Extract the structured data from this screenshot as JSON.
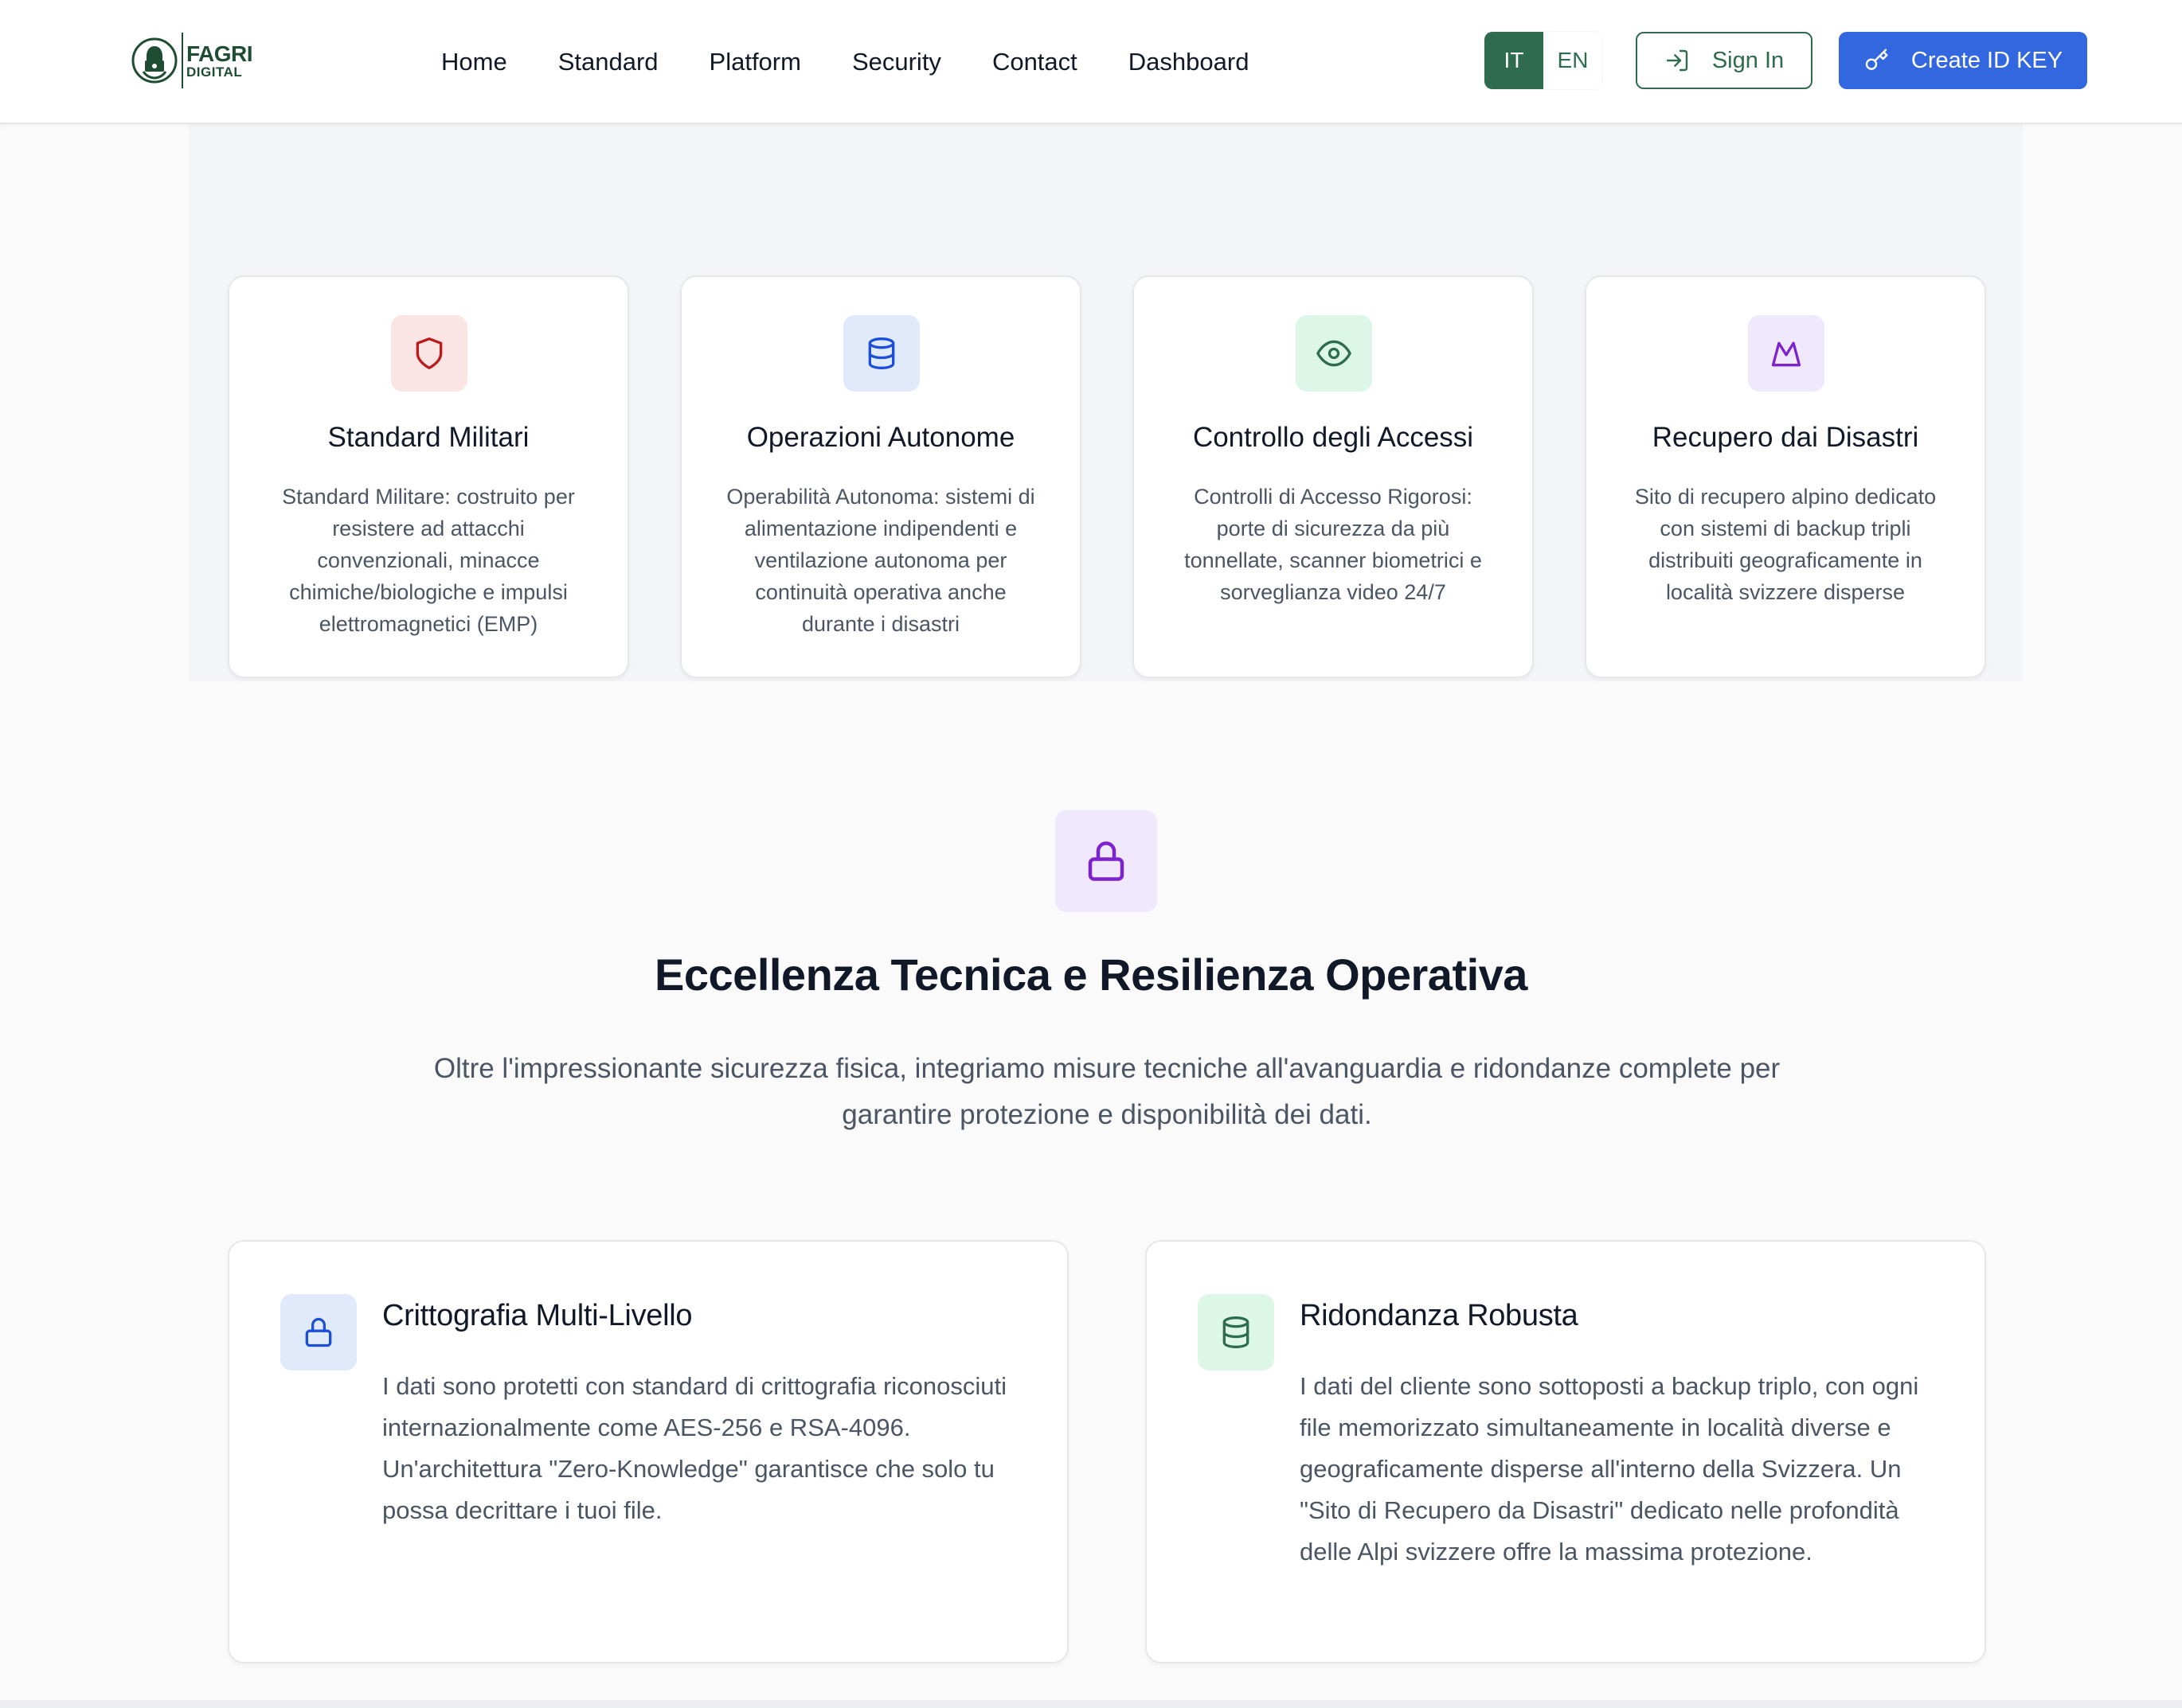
{
  "header": {
    "logo": {
      "line1": "FAGRI",
      "line2": "DIGITAL"
    },
    "nav": [
      "Home",
      "Standard",
      "Platform",
      "Security",
      "Contact",
      "Dashboard"
    ],
    "languages": {
      "active": "IT",
      "inactive": "EN"
    },
    "sign_in_label": "Sign In",
    "create_label": "Create ID KEY"
  },
  "features": [
    {
      "icon": "shield-icon",
      "title": "Standard Militari",
      "desc": "Standard Militare: costruito per resistere ad attacchi convenzionali, minacce chimiche/biologiche e impulsi elettromagnetici (EMP)"
    },
    {
      "icon": "database-icon",
      "title": "Operazioni Autonome",
      "desc": "Operabilità Autonoma: sistemi di alimentazione indipendenti e ventilazione autonoma per continuità operativa anche durante i disastri"
    },
    {
      "icon": "eye-icon",
      "title": "Controllo degli Accessi",
      "desc": "Controlli di Accesso Rigorosi: porte di sicurezza da più tonnellate, scanner biometrici e sorveglianza video 24/7"
    },
    {
      "icon": "mountain-icon",
      "title": "Recupero dai Disastri",
      "desc": "Sito di recupero alpino dedicato con sistemi di backup tripli distribuiti geograficamente in località svizzere disperse"
    }
  ],
  "excellence": {
    "icon": "lock-icon",
    "title": "Eccellenza Tecnica e Resilienza Operativa",
    "subtitle": "Oltre l'impressionante sicurezza fisica, integriamo misure tecniche all'avanguardia e ridondanze complete per garantire protezione e disponibilità dei dati."
  },
  "details": [
    {
      "icon": "lock-icon",
      "title": "Crittografia Multi-Livello",
      "desc": "I dati sono protetti con standard di crittografia riconosciuti internazionalmente come AES-256 e RSA-4096. Un'architettura \"Zero-Knowledge\" garantisce che solo tu possa decrittare i tuoi file."
    },
    {
      "icon": "database-icon",
      "title": "Ridondanza Robusta",
      "desc": "I dati del cliente sono sottoposti a backup triplo, con ogni file memorizzato simultaneamente in località diverse e geograficamente disperse all'interno della Svizzera. Un \"Sito di Recupero da Disastri\" dedicato nelle profondità delle Alpi svizzere offre la massima protezione."
    }
  ],
  "colors": {
    "brand_green": "#2f6b4f",
    "primary_blue": "#3367e0",
    "red_tint": "#fbe4e4",
    "blue_tint": "#e0eafb",
    "green_tint": "#dcf7e7",
    "purple_tint": "#f0e8fd"
  }
}
